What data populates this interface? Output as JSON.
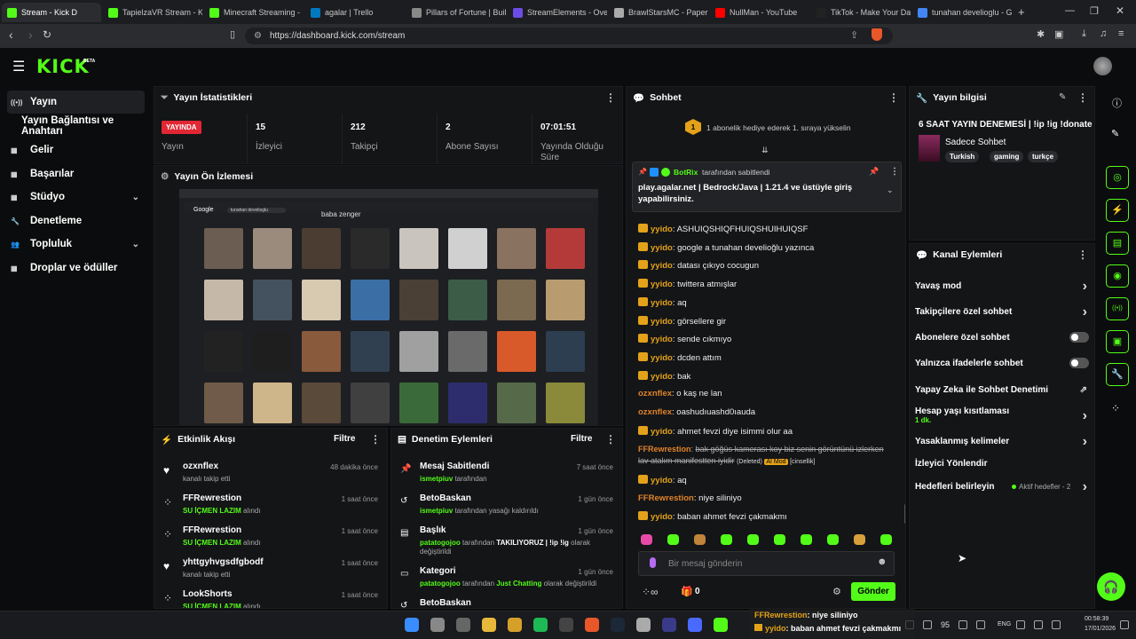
{
  "browser": {
    "tabs": [
      {
        "label": "Stream - Kick D",
        "color": "#53fc18",
        "active": true
      },
      {
        "label": "TapielzaVR Stream - K",
        "color": "#53fc18"
      },
      {
        "label": "Minecraft Streaming -",
        "color": "#53fc18"
      },
      {
        "label": "agalar | Trello",
        "color": "#0079bf"
      },
      {
        "label": "Pillars of Fortune | Buil",
        "color": "#888888"
      },
      {
        "label": "StreamElements - Ove",
        "color": "#6b4ce6"
      },
      {
        "label": "BrawlStarsMC - Paper",
        "color": "#aaaaaa"
      },
      {
        "label": "NullMan - YouTube",
        "color": "#ff0000"
      },
      {
        "label": "TikTok - Make Your Da",
        "color": "#222222"
      },
      {
        "label": "tunahan develioglu - G",
        "color": "#4285f4"
      }
    ],
    "url": "https://dashboard.kick.com/stream"
  },
  "header": {
    "logo": "KICK",
    "beta": "BETA"
  },
  "sidebar": {
    "items": [
      {
        "label": "Yayın",
        "icon": "stream-icon"
      },
      {
        "label": "Yayın Bağlantısı ve Anahtarı",
        "icon": ""
      },
      {
        "label": "Gelir",
        "icon": "revenue-icon"
      },
      {
        "label": "Başarılar",
        "icon": "achievements-icon"
      },
      {
        "label": "Stüdyo",
        "icon": "studio-icon"
      },
      {
        "label": "Denetleme",
        "icon": "moderation-icon"
      },
      {
        "label": "Topluluk",
        "icon": "community-icon"
      },
      {
        "label": "Droplar ve ödüller",
        "icon": "drops-icon"
      }
    ]
  },
  "stats": {
    "title": "Yayın İstatistikleri",
    "live_badge": "YAYINDA",
    "live_label": "Yayın",
    "items": [
      {
        "value": "15",
        "label": "İzleyici"
      },
      {
        "value": "212",
        "label": "Takipçi"
      },
      {
        "value": "2",
        "label": "Abone Sayısı"
      },
      {
        "value": "07:01:51",
        "label": "Yayında Olduğu Süre"
      }
    ]
  },
  "preview": {
    "title": "Yayın Ön İzlemesi",
    "search_logo": "Google",
    "search_query": "tunahan develioglu",
    "overlay_name": "baba zenger"
  },
  "activity": {
    "title": "Etkinlik Akışı",
    "filter": "Filtre",
    "items": [
      {
        "name": "ozxnflex",
        "sub": "kanalı takip etti",
        "time": "48 dakika önce",
        "icon": "heart-icon"
      },
      {
        "name": "FFRewrestion",
        "sub_hl": "SU İÇMEN LAZIM",
        "sub": "alındı",
        "time": "1 saat önce",
        "icon": "reward-icon"
      },
      {
        "name": "FFRewrestion",
        "sub_hl": "SU İÇMEN LAZIM",
        "sub": "alındı",
        "time": "1 saat önce",
        "icon": "reward-icon"
      },
      {
        "name": "yhttgyhvgsdfgbodf",
        "sub": "kanalı takip etti",
        "time": "1 saat önce",
        "icon": "heart-icon"
      },
      {
        "name": "LookShorts",
        "sub_hl": "SU İÇMEN LAZIM",
        "sub": "alındı",
        "time": "1 saat önce",
        "icon": "reward-icon"
      }
    ]
  },
  "moderation": {
    "title": "Denetim Eylemleri",
    "filter": "Filtre",
    "items": [
      {
        "name": "Mesaj Sabitlendi",
        "user": "ismetpiuv",
        "sub": "tarafından",
        "time": "7 saat önce",
        "icon": "pin-icon"
      },
      {
        "name": "BetoBaskan",
        "user": "ismetpiuv",
        "sub": "tarafından yasağı kaldırıldı",
        "time": "1 gün önce",
        "icon": "unban-icon"
      },
      {
        "name": "Başlık",
        "user": "patatogojoo",
        "sub": "tarafından",
        "sub_b": "TAKILIYORUZ | !ip !ig",
        "sub2": "olarak değiştirildi",
        "time": "1 gün önce",
        "icon": "title-icon"
      },
      {
        "name": "Kategori",
        "user": "patatogojoo",
        "sub": "tarafından",
        "sub_hl": "Just Chatting",
        "sub2": "olarak değiştirildi",
        "time": "1 gün önce",
        "icon": "category-icon"
      },
      {
        "name": "BetoBaskan",
        "user": "",
        "sub": "",
        "time": "",
        "icon": "unban-icon"
      }
    ]
  },
  "chat": {
    "title": "Sohbet",
    "gift_text": "1 abonelik hediye ederek 1. sıraya yükselin",
    "gift_count": "1",
    "pinned_by": "BotRix",
    "pinned_suffix": "tarafından sabitlendi",
    "pinned_text": "play.agalar.net | Bedrock/Java | 1.21.4 ve üstüyle giriş yapabilirsiniz.",
    "messages": [
      {
        "user": "yyido",
        "text": "ASHUIQSHIQFHUIQSHUIHUIQSF",
        "color": "#e3a21a",
        "crown": true
      },
      {
        "user": "yyido",
        "text": "google a tunahan develioğlu yazınca",
        "color": "#e3a21a",
        "crown": true
      },
      {
        "user": "yyido",
        "text": "datası çıkıyo cocugun",
        "color": "#e3a21a",
        "crown": true
      },
      {
        "user": "yyido",
        "text": "twittera atmışlar",
        "color": "#e3a21a",
        "crown": true
      },
      {
        "user": "yyido",
        "text": "aq",
        "color": "#e3a21a",
        "crown": true
      },
      {
        "user": "yyido",
        "text": "görsellere gir",
        "color": "#e3a21a",
        "crown": true
      },
      {
        "user": "yyido",
        "text": "sende cıkmıyo",
        "color": "#e3a21a",
        "crown": true
      },
      {
        "user": "yyido",
        "text": "dcden attım",
        "color": "#e3a21a",
        "crown": true
      },
      {
        "user": "yyido",
        "text": "bak",
        "color": "#e3a21a",
        "crown": true
      },
      {
        "user": "ozxnflex",
        "text": "o kaş ne lan",
        "color": "#e0832a",
        "crown": false
      },
      {
        "user": "ozxnflex",
        "text": "oashudıuashd0ıauda",
        "color": "#e0832a",
        "crown": false
      },
      {
        "user": "yyido",
        "text": "ahmet fevzi diye isimmi olur aa",
        "color": "#e3a21a",
        "crown": true
      }
    ],
    "deleted": {
      "user": "FFRewrestion",
      "text": "bak göğüs kamerası koy biz senin görüntünü izlerken lav atalım manifestten iyidir",
      "tag1": "(Deleted)",
      "tag2": "AI Mod",
      "tag3": "[cinsellik]"
    },
    "after": [
      {
        "user": "yyido",
        "text": "aq",
        "color": "#e3a21a",
        "crown": true
      },
      {
        "user": "FFRewrestion",
        "text": "niye siliniyo",
        "color": "#e0832a",
        "crown": false
      },
      {
        "user": "yyido",
        "text": "baban ahmet fevzi çakmakmı",
        "color": "#e3a21a",
        "crown": true
      }
    ],
    "input_placeholder": "Bir mesaj gönderin",
    "points": "0",
    "send": "Gönder"
  },
  "stream_info": {
    "title": "Yayın bilgisi",
    "stream_title": "6 SAAT YAYIN DENEMESİ | !ip !ig !donate",
    "category": "Sadece Sohbet",
    "tags": [
      "Turkish",
      "gaming",
      "turkçe"
    ]
  },
  "channel_actions": {
    "title": "Kanal Eylemleri",
    "items": [
      {
        "label": "Yavaş mod",
        "type": "arrow"
      },
      {
        "label": "Takipçilere özel sohbet",
        "type": "arrow"
      },
      {
        "label": "Abonelere özel sohbet",
        "type": "toggle"
      },
      {
        "label": "Yalnızca ifadelerle sohbet",
        "type": "toggle"
      },
      {
        "label": "Yapay Zeka ile Sohbet Denetimi",
        "type": "external"
      },
      {
        "label": "Hesap yaşı kısıtlaması",
        "sub": "1 dk.",
        "type": "arrow"
      },
      {
        "label": "Yasaklanmış kelimeler",
        "type": "arrow"
      },
      {
        "label": "İzleyici Yönlendir",
        "type": "none"
      },
      {
        "label": "Hedefleri belirleyin",
        "badge": "Aktif hedefler - 2",
        "type": "arrow"
      }
    ]
  },
  "overlay_chat": [
    {
      "user": "FFRewrestion",
      "text": ": niye siliniyo"
    },
    {
      "user": "yyido",
      "text": ": baban ahmet fevzi çakmakmı"
    }
  ],
  "taskbar": {
    "battery": "95",
    "lang": "ENG",
    "time": "00:58:39",
    "date": "17/01/2026"
  },
  "accent": "#53fc18"
}
